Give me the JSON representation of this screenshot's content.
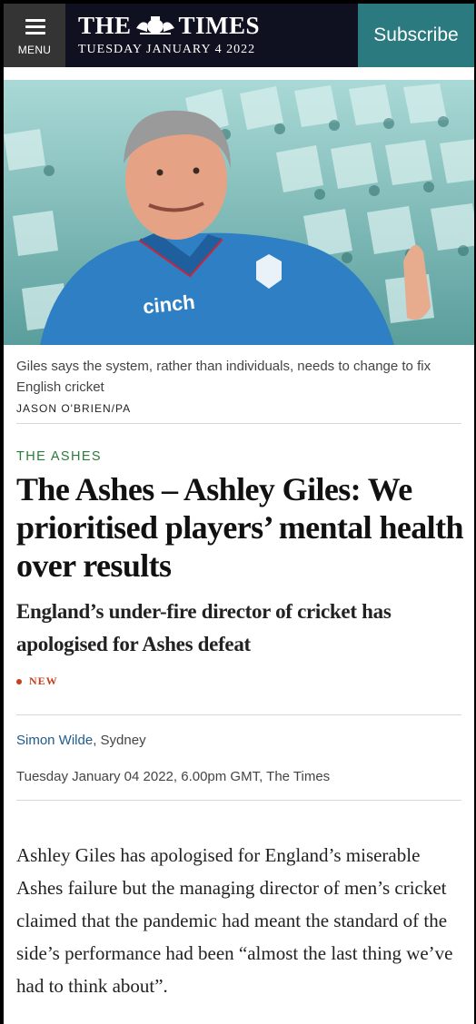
{
  "header": {
    "menu_label": "MENU",
    "brand_left": "THE",
    "brand_right": "TIMES",
    "date": "TUESDAY JANUARY 4 2022",
    "subscribe_label": "Subscribe"
  },
  "hero": {
    "caption": "Giles says the system, rather than individuals, needs to change to fix English cricket",
    "credit": "JASON O'BRIEN/PA",
    "shirt_text": "cinch"
  },
  "article": {
    "section": "THE ASHES",
    "headline": "The Ashes – Ashley Giles: We prioritised players’ mental health over results",
    "standfirst": "England’s under-fire director of cricket has apologised for Ashes defeat",
    "badge": "NEW",
    "author": "Simon Wilde",
    "location": ", Sydney",
    "published": "Tuesday January 04 2022, 6.00pm GMT, The Times",
    "body": "Ashley Giles has apologised for England’s miserable Ashes failure but the managing director of men’s cricket claimed that the pandemic had meant the standard of the side’s performance had been “almost the last thing we’ve had to think about”."
  },
  "colors": {
    "masthead_bg": "#101120",
    "menu_bg": "#343434",
    "subscribe_bg": "#2b7a7f",
    "section_green": "#2c7a38",
    "author_blue": "#1f5c8c",
    "new_red": "#c5401f"
  }
}
